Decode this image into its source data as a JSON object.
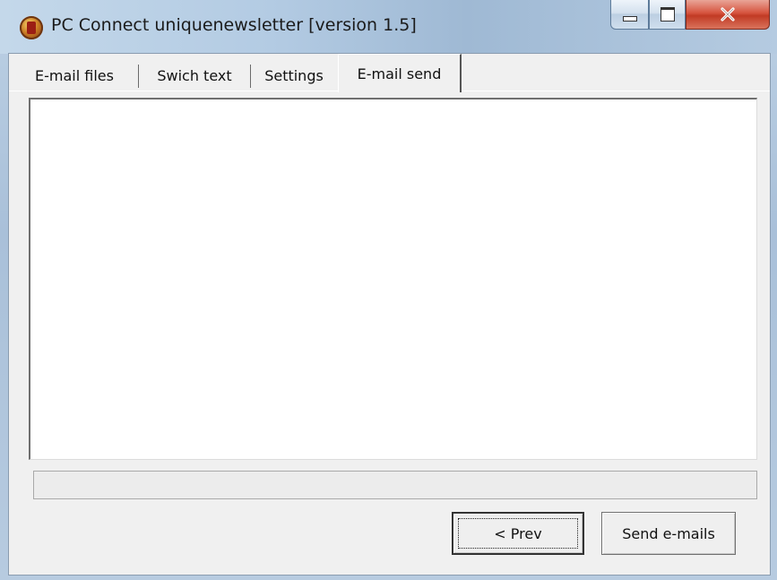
{
  "window": {
    "title": "PC Connect uniquenewsletter [version 1.5]"
  },
  "caption_buttons": {
    "minimize_icon": "minimize-icon",
    "maximize_icon": "maximize-icon",
    "close_icon": "close-icon"
  },
  "tabs": [
    {
      "label": "E-mail files",
      "active": false
    },
    {
      "label": "Swich text",
      "active": false
    },
    {
      "label": "Settings",
      "active": false
    },
    {
      "label": "E-mail send",
      "active": true
    }
  ],
  "log_panel": {
    "content": ""
  },
  "status": {
    "text": ""
  },
  "buttons": {
    "prev_label": "< Prev",
    "send_label": "Send e-mails"
  },
  "colors": {
    "close_button": "#c13a24",
    "client_background": "#f0f0f0",
    "title_bar": "#b3cbe3"
  }
}
